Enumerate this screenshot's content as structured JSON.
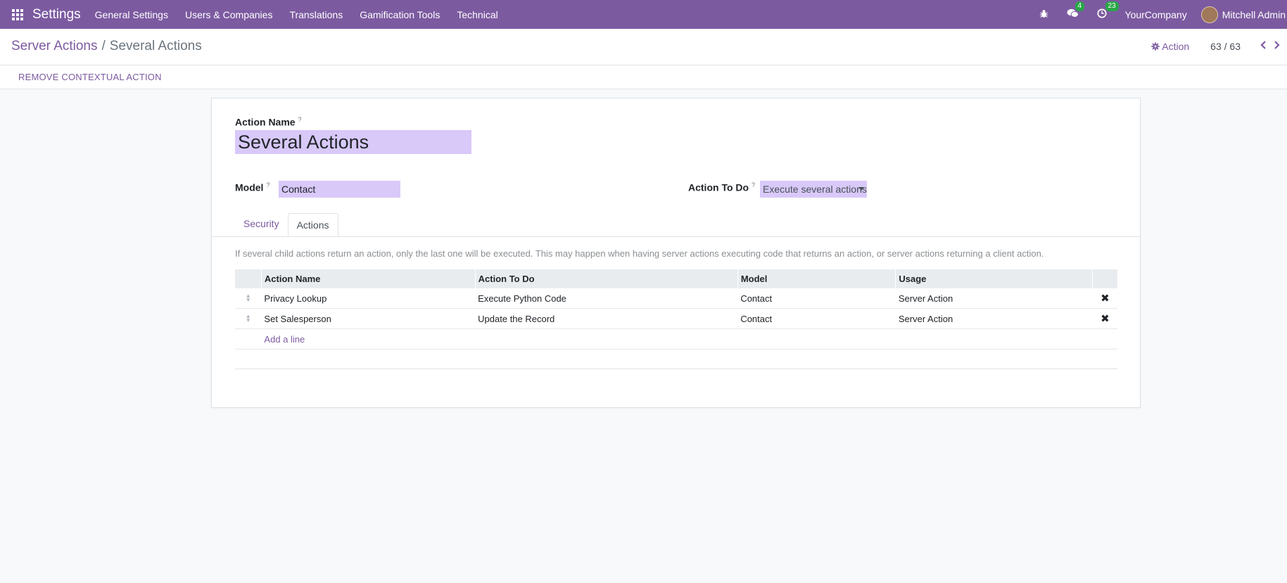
{
  "navbar": {
    "app_name": "Settings",
    "menu": [
      "General Settings",
      "Users & Companies",
      "Translations",
      "Gamification Tools",
      "Technical"
    ],
    "messages_badge": "4",
    "activities_badge": "23",
    "company": "YourCompany",
    "user": "Mitchell Admin"
  },
  "breadcrumb": {
    "parent": "Server Actions",
    "separator": "/",
    "current": "Several Actions"
  },
  "control": {
    "action_label": "Action",
    "pager": "63 / 63",
    "remove_label": "REMOVE CONTEXTUAL ACTION"
  },
  "form": {
    "name_label": "Action Name",
    "name_value": "Several Actions",
    "model_label": "Model",
    "model_value": "Contact",
    "todo_label": "Action To Do",
    "todo_value": "Execute several actions",
    "help_mark": "?"
  },
  "tabs": [
    {
      "label": "Security",
      "active": false
    },
    {
      "label": "Actions",
      "active": true
    }
  ],
  "help_text": "If several child actions return an action, only the last one will be executed. This may happen when having server actions executing code that returns an action, or server actions returning a client action.",
  "table": {
    "headers": [
      "Action Name",
      "Action To Do",
      "Model",
      "Usage"
    ],
    "rows": [
      {
        "name": "Privacy Lookup",
        "todo": "Execute Python Code",
        "model": "Contact",
        "usage": "Server Action"
      },
      {
        "name": "Set Salesperson",
        "todo": "Update the Record",
        "model": "Contact",
        "usage": "Server Action"
      }
    ],
    "add_line": "Add a line"
  },
  "colors": {
    "brand": "#7c5aa0",
    "input_bg": "#d8c9f9",
    "badge": "#28a745"
  }
}
